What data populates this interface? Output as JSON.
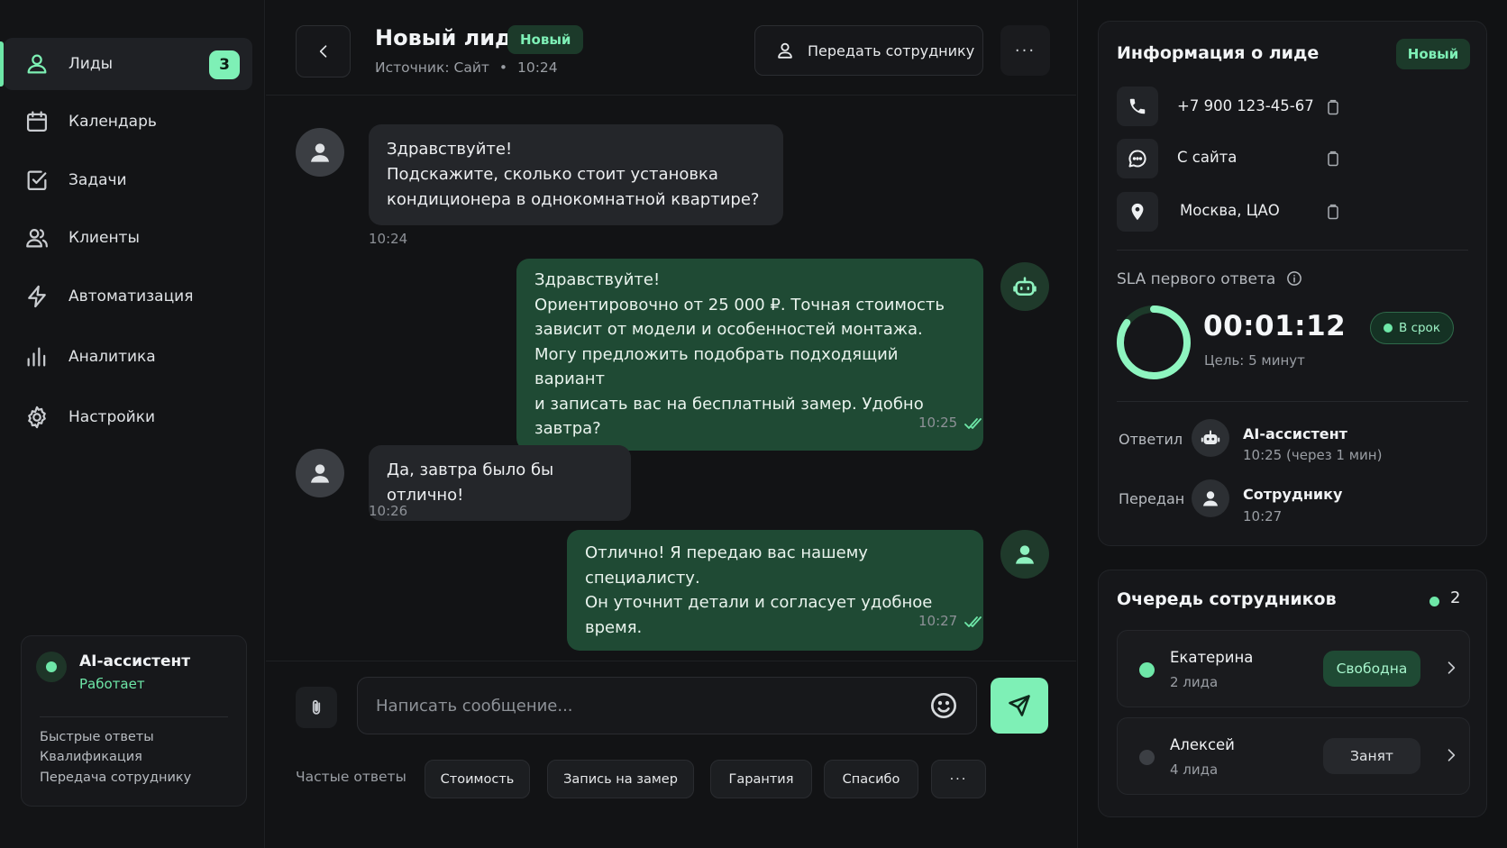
{
  "colors": {
    "accent": "#7ef0b6",
    "accent_dark": "#1f4a34",
    "background": "#111214",
    "surface": "#16171a",
    "status_free": "#6ee7a8",
    "status_busy": "#3c3f44"
  },
  "sidebar": {
    "items": [
      {
        "label": "Лиды",
        "icon": "user-icon",
        "badge": "3",
        "active": true
      },
      {
        "label": "Календарь",
        "icon": "calendar-icon"
      },
      {
        "label": "Задачи",
        "icon": "checkbox-icon"
      },
      {
        "label": "Клиенты",
        "icon": "users-icon"
      },
      {
        "label": "Автоматизация",
        "icon": "lightning-icon"
      },
      {
        "label": "Аналитика",
        "icon": "bar-chart-icon"
      },
      {
        "label": "Настройки",
        "icon": "gear-icon"
      }
    ],
    "ai_card": {
      "title": "AI-ассистент",
      "status": "Работает",
      "links": [
        "Быстрые ответы",
        "Квалификация",
        "Передача сотруднику"
      ]
    }
  },
  "chat": {
    "title": "Новый лид",
    "badge": "Новый",
    "source": "Источник: Сайт",
    "separator": "•",
    "time": "10:24",
    "transfer_label": "Передать сотруднику",
    "more_label": "···",
    "messages": [
      {
        "direction": "in",
        "lines": [
          "Здравствуйте!",
          "Подскажите, сколько стоит установка",
          "кондиционера в однокомнатной квартире?"
        ],
        "time": "10:24"
      },
      {
        "direction": "out",
        "sender": "bot",
        "lines": [
          "Здравствуйте!",
          "Ориентировочно от 25 000 ₽. Точная стоимость",
          "зависит от модели и особенностей монтажа.",
          "Могу предложить подобрать подходящий вариант",
          "и записать вас на бесплатный замер. Удобно завтра?"
        ],
        "time": "10:25"
      },
      {
        "direction": "in",
        "lines": [
          "Да, завтра было бы отлично!"
        ],
        "time": "10:26"
      },
      {
        "direction": "out",
        "sender": "agent",
        "lines": [
          "Отлично! Я передаю вас нашему специалисту.",
          "Он уточнит детали и согласует удобное время."
        ],
        "time": "10:27"
      }
    ],
    "composer": {
      "placeholder": "Написать сообщение...",
      "quick_label": "Частые ответы",
      "quick_replies": [
        "Стоимость",
        "Запись на замер",
        "Гарантия",
        "Спасибо"
      ],
      "quick_more": "···"
    }
  },
  "lead_info": {
    "title": "Информация о лиде",
    "badge": "Новый",
    "phone": "+7 900 123-45-67",
    "channel": "С сайта",
    "location": "Москва, ЦАО",
    "sla": {
      "label": "SLA первого ответа",
      "time": "00:01:12",
      "goal": "Цель: 5 минут",
      "status": "В срок",
      "progress": 0.85
    },
    "answered": {
      "label": "Ответил",
      "name": "AI-ассистент",
      "detail": "10:25 (через 1 мин)"
    },
    "transferred": {
      "label": "Передан",
      "name": "Сотруднику",
      "detail": "10:27"
    }
  },
  "queue": {
    "title": "Очередь сотрудников",
    "count": "2",
    "employees": [
      {
        "name": "Екатерина",
        "leads": "2 лида",
        "status": "Свободна",
        "free": true
      },
      {
        "name": "Алексей",
        "leads": "4 лида",
        "status": "Занят",
        "free": false
      }
    ]
  }
}
